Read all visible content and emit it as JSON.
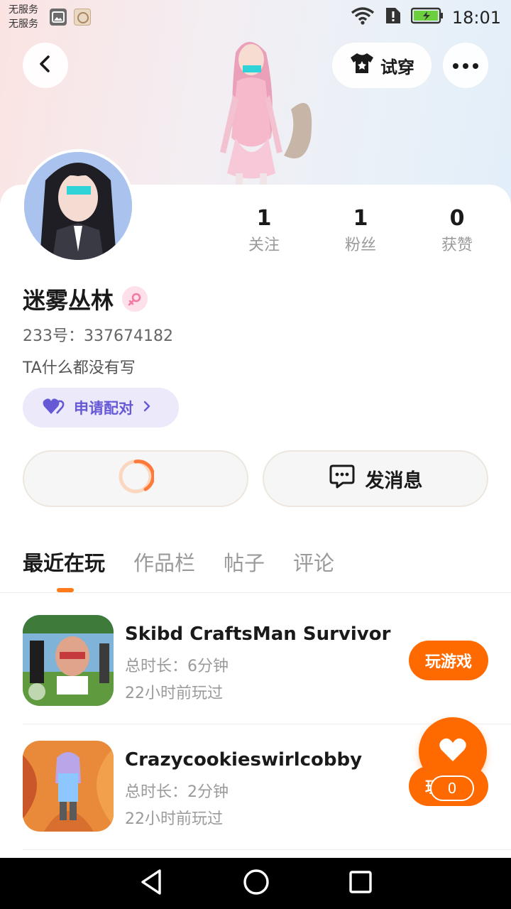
{
  "status_bar": {
    "carrier_line1": "无服务",
    "carrier_line2": "无服务",
    "time": "18:01"
  },
  "header": {
    "back_icon": "chevron-left-icon",
    "tryon_label": "试穿",
    "tryon_icon": "shirt-icon",
    "more_icon": "more-dots-icon"
  },
  "profile": {
    "stats": [
      {
        "value": "1",
        "label": "关注"
      },
      {
        "value": "1",
        "label": "粉丝"
      },
      {
        "value": "0",
        "label": "获赞"
      }
    ],
    "name": "迷雾丛林",
    "gender_icon": "female-icon",
    "uid": "233号：337674182",
    "bio": "TA什么都没有写",
    "match_label": "申请配对"
  },
  "actions": {
    "message_label": "发消息"
  },
  "tabs": [
    "最近在玩",
    "作品栏",
    "帖子",
    "评论"
  ],
  "games": [
    {
      "title": "Skibd CraftsMan Survivor",
      "duration": "总时长：6分钟",
      "last_played": "22小时前玩过",
      "play_label": "玩游戏"
    },
    {
      "title": "Crazycookieswirlcobby",
      "duration": "总时长：2分钟",
      "last_played": "22小时前玩过",
      "play_label": "玩游戏"
    }
  ],
  "favorite": {
    "count": "0"
  },
  "colors": {
    "accent": "#ff6a00",
    "match_text": "#6659d6",
    "match_bg": "#ece9fb"
  }
}
